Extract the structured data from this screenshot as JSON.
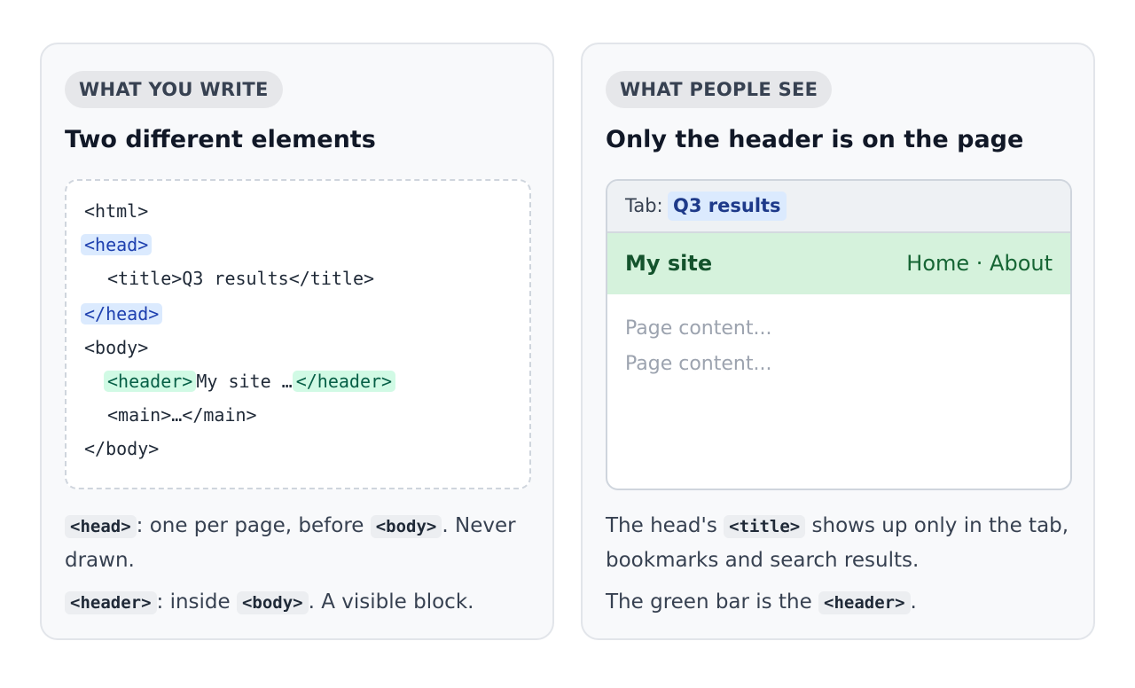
{
  "left": {
    "pill": "WHAT YOU WRITE",
    "title": "Two different elements",
    "code": {
      "l1": "<html>",
      "l2": "<head>",
      "l3": "<title>Q3 results</title>",
      "l4": "</head>",
      "l5": "<body>",
      "l6_open": "<header>",
      "l6_text": "My site …",
      "l6_close": "</header>",
      "l7": "<main>…</main>",
      "l8": "</body>"
    },
    "note1": {
      "code1": "<head>",
      "text1": ": one per page, before ",
      "code2": "<body>",
      "text2": ". Never drawn."
    },
    "note2": {
      "code1": "<header>",
      "text1": ": inside ",
      "code2": "<body>",
      "text2": ". A visible block."
    }
  },
  "right": {
    "pill": "WHAT PEOPLE SEE",
    "title": "Only the header is on the page",
    "browser": {
      "tab_label": "Tab:",
      "tab_title": "Q3 results",
      "site_name": "My site",
      "nav": "Home · About",
      "content1": "Page content...",
      "content2": "Page content..."
    },
    "note1": {
      "text1": "The head's ",
      "code1": "<title>",
      "text2": " shows up only in the tab, bookmarks and search results."
    },
    "note2": {
      "text1": "The green bar is the ",
      "code1": "<header>",
      "text2": "."
    }
  },
  "colors": {
    "head_highlight": "#dbeafe",
    "header_highlight": "#d1fae5",
    "site_header_bg": "#d5f2dc"
  }
}
